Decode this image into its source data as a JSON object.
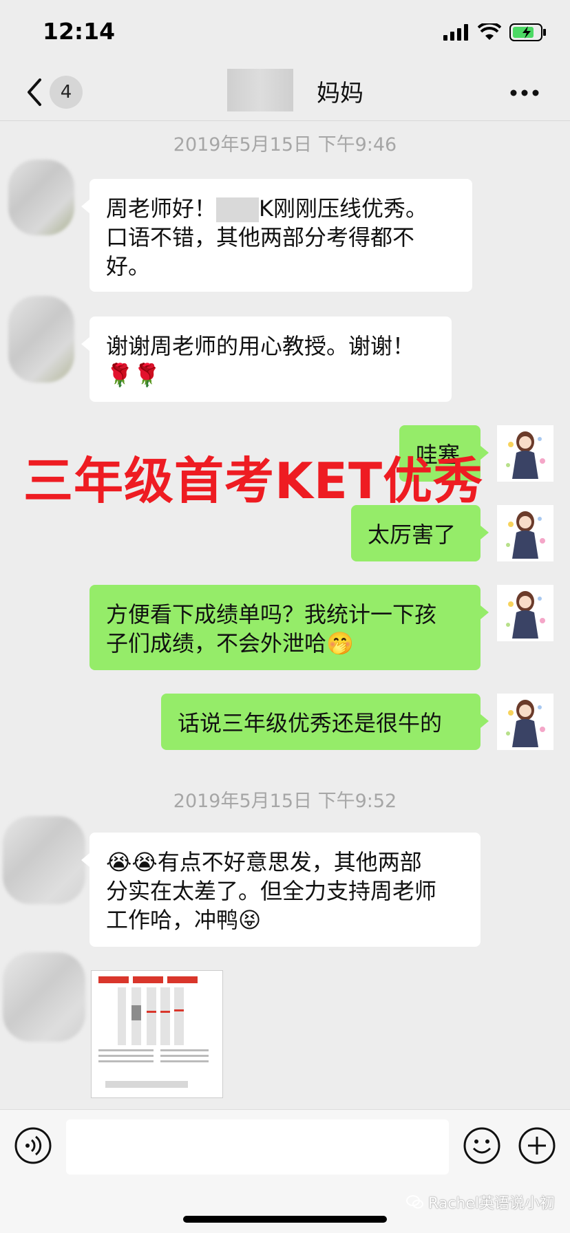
{
  "status_bar": {
    "time": "12:14"
  },
  "nav": {
    "unread_count": "4",
    "title_suffix": "妈妈",
    "back_icon": "chevron-left-icon",
    "more_icon": "ellipsis-icon"
  },
  "chat": {
    "timestamp_1": "2019年5月15日 下午9:46",
    "timestamp_2": "2019年5月15日 下午9:52",
    "msg_1_line1": "周老师好！",
    "msg_1_line1b": "K刚刚压线优秀。",
    "msg_1_line2": "口语不错，其他两部分考得都不",
    "msg_1_line3": "好。",
    "msg_2_line1": "谢谢周老师的用心教授。谢谢！",
    "msg_2_line2": "🌹🌹",
    "msg_3": "哇塞",
    "msg_4": "太厉害了",
    "msg_5_line1": "方便看下成绩单吗？我统计一下孩",
    "msg_5_line2": "子们成绩，不会外泄哈🤭",
    "msg_6": "话说三年级优秀还是很牛的",
    "msg_7_line1": "😭😭有点不好意思发，其他两部",
    "msg_7_line2": "分实在太差了。但全力支持周老师",
    "msg_7_line3": "工作哈，冲鸭😝"
  },
  "overlay_caption": "三年级首考KET优秀",
  "watermark": "Rachel英语说小初",
  "colors": {
    "background": "#ededed",
    "bubble_sent": "#95ec69",
    "bubble_received": "#ffffff",
    "caption": "#ee1c22",
    "timestamp": "#a6a6a6"
  }
}
